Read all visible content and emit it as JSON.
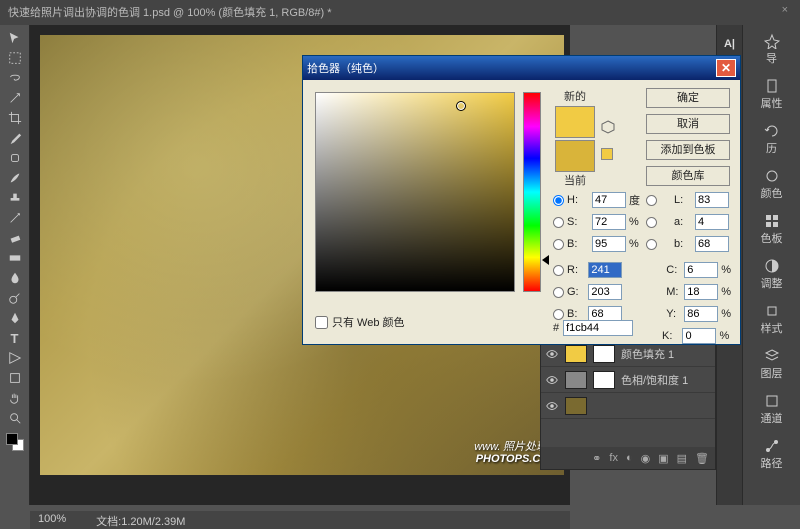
{
  "titlebar": {
    "doc_title": "快速给照片调出协调的色调 1.psd @ 100% (颜色填充 1, RGB/8#) *",
    "close": "×"
  },
  "status": {
    "zoom": "100%",
    "docinfo": "文档:1.20M/2.39M"
  },
  "watermark": {
    "small": "www.",
    "big1": "照片处理网",
    "big2": "PHOTOPS.COM"
  },
  "right_panels": {
    "items": [
      "导",
      "属性",
      "历",
      "颜色",
      "色板",
      "调整",
      "样式",
      "图层",
      "通道",
      "路径"
    ]
  },
  "layers": {
    "rows": [
      {
        "name": "颜色填充 1",
        "thumb": "#f1cb44"
      },
      {
        "name": "色相/饱和度 1",
        "thumb": "#888"
      }
    ]
  },
  "dialog": {
    "title": "拾色器（纯色）",
    "labels": {
      "new": "新的",
      "current": "当前"
    },
    "buttons": {
      "ok": "确定",
      "cancel": "取消",
      "add": "添加到色板",
      "lib": "颜色库"
    },
    "web_only": "只有 Web 颜色",
    "hsb": {
      "H": {
        "label": "H:",
        "value": "47",
        "unit": "度"
      },
      "S": {
        "label": "S:",
        "value": "72",
        "unit": "%"
      },
      "B": {
        "label": "B:",
        "value": "95",
        "unit": "%"
      }
    },
    "rgb": {
      "R": {
        "label": "R:",
        "value": "241"
      },
      "G": {
        "label": "G:",
        "value": "203"
      },
      "B": {
        "label": "B:",
        "value": "68"
      }
    },
    "lab": {
      "L": {
        "label": "L:",
        "value": "83"
      },
      "a": {
        "label": "a:",
        "value": "4"
      },
      "b": {
        "label": "b:",
        "value": "68"
      }
    },
    "cmyk": {
      "C": {
        "label": "C:",
        "value": "6",
        "unit": "%"
      },
      "M": {
        "label": "M:",
        "value": "18",
        "unit": "%"
      },
      "Y": {
        "label": "Y:",
        "value": "86",
        "unit": "%"
      },
      "K": {
        "label": "K:",
        "value": "0",
        "unit": "%"
      }
    },
    "hex": {
      "prefix": "#",
      "value": "f1cb44"
    }
  }
}
